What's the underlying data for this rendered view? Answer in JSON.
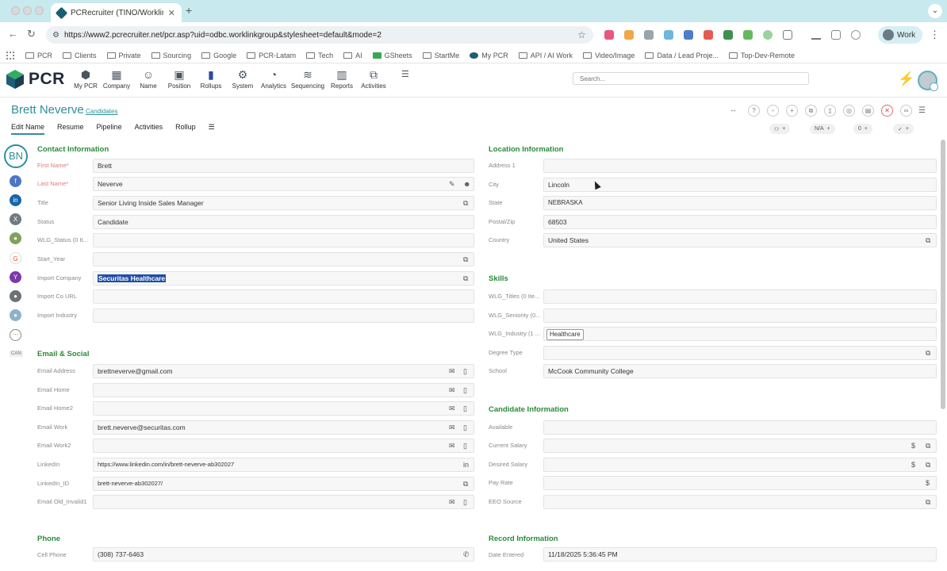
{
  "browser": {
    "tab_title": "PCRecruiter (TINO/Worklink",
    "url": "https://www2.pcrecruiter.net/pcr.asp?uid=odbc.worklinkgroup&stylesheet=default&mode=2",
    "profile_label": "Work",
    "bookmarks": [
      "PCR",
      "Clients",
      "Private",
      "Sourcing",
      "Google",
      "PCR-Latam",
      "Tech",
      "AI",
      "GSheets",
      "StartMe",
      "My PCR",
      "API / AI Work",
      "Video/Image",
      "Data / Lead Proje...",
      "Top-Dev-Remote"
    ]
  },
  "app": {
    "logo": "PCR",
    "nav": [
      {
        "label": "My PCR",
        "icon": "cube-icon"
      },
      {
        "label": "Company",
        "icon": "building-icon"
      },
      {
        "label": "Name",
        "icon": "person-icon"
      },
      {
        "label": "Position",
        "icon": "briefcase-icon"
      },
      {
        "label": "Rollups",
        "icon": "book-icon"
      },
      {
        "label": "System",
        "icon": "gear-icon"
      },
      {
        "label": "Analytics",
        "icon": "gauge-icon"
      },
      {
        "label": "Sequencing",
        "icon": "sequence-icon"
      },
      {
        "label": "Reports",
        "icon": "bar-chart-icon"
      },
      {
        "label": "Activities",
        "icon": "activities-icon"
      }
    ],
    "search_placeholder": "Search..."
  },
  "record": {
    "name": "Brett Neverve",
    "type_link": "Candidates",
    "initials": "BN",
    "subtabs": [
      "Edit Name",
      "Resume",
      "Pipeline",
      "Activities",
      "Rollup"
    ],
    "pills": [
      "N/A",
      "0"
    ],
    "rail_badge": "CAN"
  },
  "contact": {
    "title": "Contact Information",
    "fields": [
      {
        "label": "First Name*",
        "value": "Brett",
        "required": true
      },
      {
        "label": "Last Name*",
        "value": "Neverve",
        "required": true
      },
      {
        "label": "Title",
        "value": "Senior Living Inside Sales Manager"
      },
      {
        "label": "Status",
        "value": "Candidate"
      },
      {
        "label": "WLG_Status (0 It...",
        "value": ""
      },
      {
        "label": "Start_Year",
        "value": ""
      },
      {
        "label": "Import Company",
        "value": "Securitas Healthcare"
      },
      {
        "label": "Import Co URL",
        "value": ""
      },
      {
        "label": "Import Industry",
        "value": ""
      }
    ]
  },
  "email": {
    "title": "Email & Social",
    "fields": [
      {
        "label": "Email Address",
        "value": "brettneverve@gmail.com"
      },
      {
        "label": "Email Home",
        "value": ""
      },
      {
        "label": "Email Home2",
        "value": ""
      },
      {
        "label": "Email Work",
        "value": "brett.neverve@securitas.com"
      },
      {
        "label": "Email Work2",
        "value": ""
      },
      {
        "label": "LinkedIn",
        "value": "https://www.linkedin.com/in/brett-neverve-ab302027"
      },
      {
        "label": "LinkedIn_ID",
        "value": "brett-neverve-ab302027/"
      },
      {
        "label": "Email Old_Invalid1",
        "value": ""
      }
    ]
  },
  "phone": {
    "title": "Phone",
    "fields": [
      {
        "label": "Cell Phone",
        "value": "(308) 737-6463"
      }
    ]
  },
  "location": {
    "title": "Location Information",
    "fields": [
      {
        "label": "Address 1",
        "value": ""
      },
      {
        "label": "City",
        "value": "Lincoln"
      },
      {
        "label": "State",
        "value": "NEBRASKA"
      },
      {
        "label": "Postal/Zip",
        "value": "68503"
      },
      {
        "label": "Country",
        "value": "United States"
      }
    ]
  },
  "skills": {
    "title": "Skills",
    "fields": [
      {
        "label": "WLG_Titles (0 Ite...",
        "value": ""
      },
      {
        "label": "WLG_Seniority (0...",
        "value": ""
      },
      {
        "label": "WLG_Industry (1 ...",
        "value": "Healthcare"
      },
      {
        "label": "Degree Type",
        "value": ""
      },
      {
        "label": "School",
        "value": "McCook Community College"
      }
    ]
  },
  "candidate": {
    "title": "Candidate Information",
    "fields": [
      {
        "label": "Available",
        "value": ""
      },
      {
        "label": "Current Salary",
        "value": ""
      },
      {
        "label": "Desired Salary",
        "value": ""
      },
      {
        "label": "Pay Rate",
        "value": ""
      },
      {
        "label": "EEO Source",
        "value": ""
      }
    ]
  },
  "record_info": {
    "title": "Record Information",
    "fields": [
      {
        "label": "Date Entered",
        "value": "11/18/2025 5:36:45 PM"
      }
    ]
  },
  "colors": {
    "accent": "#2e8f9c",
    "section": "#2a8a3a",
    "selection": "#1f4fa8"
  }
}
